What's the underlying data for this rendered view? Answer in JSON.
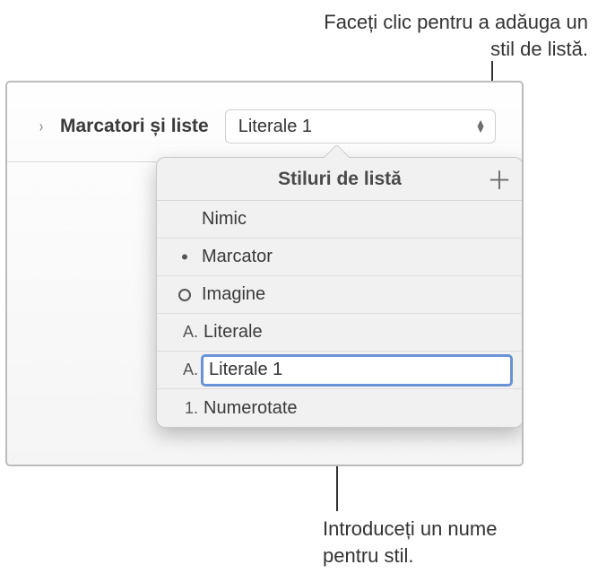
{
  "annotations": {
    "top": "Faceți clic pentru a adăuga un stil de listă.",
    "bottom": "Introduceți un nume pentru stil."
  },
  "section": {
    "label": "Marcatori și liste",
    "popup_value": "Literale 1"
  },
  "popover": {
    "title": "Stiluri de listă",
    "add_symbol": "＋",
    "items": [
      {
        "icon": "",
        "icon_type": "blank",
        "label": "Nimic"
      },
      {
        "icon": "•",
        "icon_type": "dot",
        "label": "Marcator"
      },
      {
        "icon": "○",
        "icon_type": "circle",
        "label": "Imagine"
      },
      {
        "icon": "A.",
        "icon_type": "letter",
        "label": "Literale"
      },
      {
        "icon": "A.",
        "icon_type": "letter",
        "label": "Literale 1",
        "editing": true
      },
      {
        "icon": "1.",
        "icon_type": "number",
        "label": "Numerotate"
      }
    ]
  }
}
